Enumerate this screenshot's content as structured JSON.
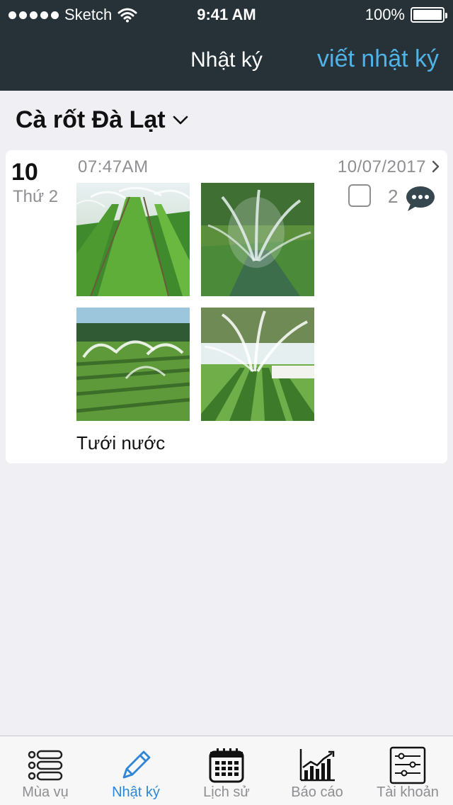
{
  "status_bar": {
    "carrier": "Sketch",
    "time": "9:41 AM",
    "battery": "100%"
  },
  "nav": {
    "title": "Nhật ký",
    "action": "viết nhật ký"
  },
  "crop": {
    "name": "Cà rốt Đà Lạt"
  },
  "entry": {
    "day": "10",
    "weekday": "Thứ 2",
    "time": "07:47AM",
    "date": "10/07/2017",
    "comment_count": "2",
    "caption": "Tưới nước",
    "photos": [
      "irrigation-photo-1",
      "irrigation-photo-2",
      "irrigation-photo-3",
      "irrigation-photo-4"
    ]
  },
  "tabs": [
    {
      "label": "Mùa vụ",
      "icon": "list-icon"
    },
    {
      "label": "Nhật ký",
      "icon": "pencil-icon"
    },
    {
      "label": "Lịch sử",
      "icon": "calendar-icon"
    },
    {
      "label": "Báo cáo",
      "icon": "chart-icon"
    },
    {
      "label": "Tài khoản",
      "icon": "settings-sliders-icon"
    }
  ],
  "colors": {
    "nav_background": "#263238",
    "accent": "#4fb3e8",
    "tab_active": "#2f86d6",
    "page_background": "#efeff4"
  }
}
